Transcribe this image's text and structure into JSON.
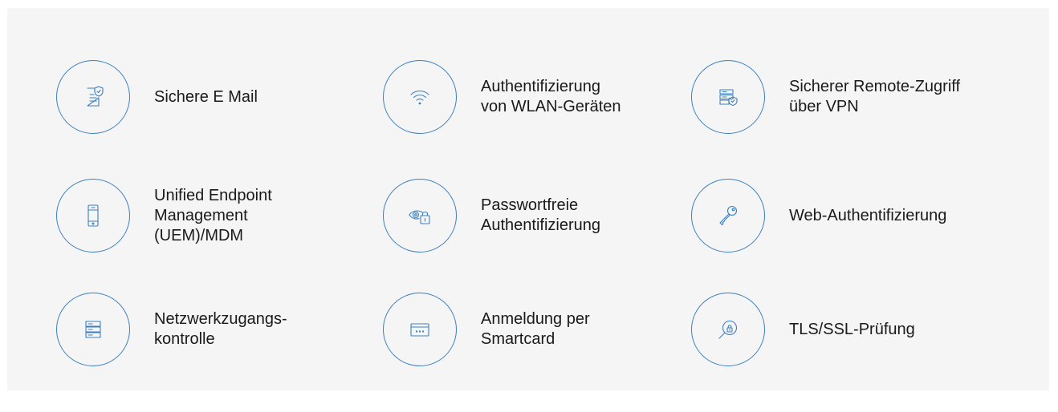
{
  "items": [
    {
      "label": "Sichere E Mail",
      "icon": "document-shield-icon"
    },
    {
      "label": "Authentifizierung\nvon WLAN-Geräten",
      "icon": "wifi-icon"
    },
    {
      "label": "Sicherer Remote-Zugriff\nüber VPN",
      "icon": "server-shield-icon"
    },
    {
      "label": "Unified Endpoint\nManagement\n(UEM)/MDM",
      "icon": "smartphone-icon"
    },
    {
      "label": "Passwortfreie\nAuthentifizierung",
      "icon": "eye-lock-icon"
    },
    {
      "label": "Web-Authentifizierung",
      "icon": "key-icon"
    },
    {
      "label": "Netzwerkzugangs-\nkontrolle",
      "icon": "server-stack-icon"
    },
    {
      "label": "Anmeldung per\nSmartcard",
      "icon": "smartcard-icon"
    },
    {
      "label": "TLS/SSL-Prüfung",
      "icon": "magnifier-lock-icon"
    }
  ],
  "colors": {
    "accent": "#3a7fc1",
    "panel_background": "#f5f5f5",
    "text": "#1a1a1a"
  }
}
